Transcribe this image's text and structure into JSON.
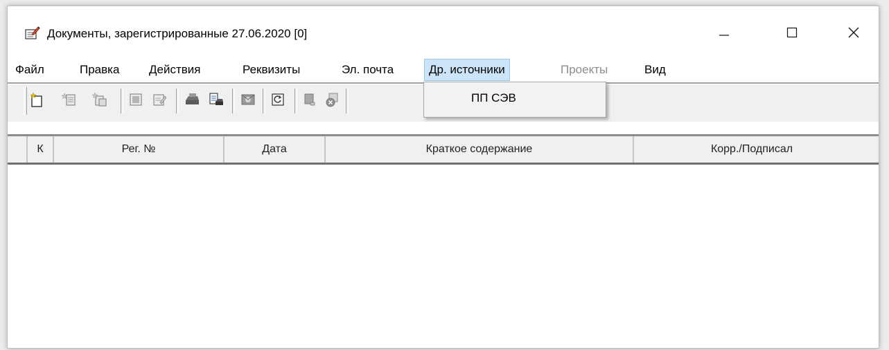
{
  "window": {
    "title": "Документы, зарегистрированные 27.06.2020  [0]",
    "icon": "document-edit-icon"
  },
  "menubar": {
    "items": [
      {
        "label": "Файл"
      },
      {
        "label": "Правка"
      },
      {
        "label": "Действия"
      },
      {
        "label": "Реквизиты"
      },
      {
        "label": "Эл. почта"
      },
      {
        "label": "Др. источники"
      },
      {
        "label": "Проекты"
      },
      {
        "label": "Вид"
      }
    ],
    "active": "Др. источники",
    "disabled": [
      "Проекты"
    ]
  },
  "dropdown": {
    "items": [
      {
        "label": "ПП СЭВ"
      }
    ]
  },
  "toolbar": {
    "buttons": [
      "new-document-icon",
      "new-incoming-icon",
      "new-outgoing-icon",
      "view-card-icon",
      "edit-card-icon",
      "print-icon",
      "print-report-icon",
      "mail-icon",
      "refresh-icon",
      "attach-icon",
      "delete-icon"
    ]
  },
  "table": {
    "columns": [
      {
        "label": ""
      },
      {
        "label": "К"
      },
      {
        "label": "Рег. №"
      },
      {
        "label": "Дата"
      },
      {
        "label": "Краткое содержание"
      },
      {
        "label": "Корр./Подписал"
      }
    ],
    "rows": []
  },
  "colors": {
    "menu_active_bg": "#cce4f7",
    "menu_active_border": "#99c9ef",
    "disabled_text": "#8c8c8c",
    "toolbar_bg": "#f0f0f0"
  }
}
